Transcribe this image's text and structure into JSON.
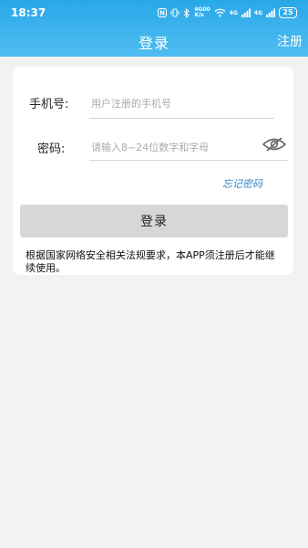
{
  "status": {
    "time": "18:37",
    "speed": "4G00\nK/s",
    "signal1": "4G",
    "signal2": "4G",
    "battery": "25"
  },
  "nav": {
    "title": "登录",
    "register_label": "注册"
  },
  "form": {
    "phone_label": "手机号:",
    "phone_placeholder": "用户注册的手机号",
    "password_label": "密码:",
    "password_placeholder": "请输入8~24位数字和字母",
    "forgot_label": "忘记密码",
    "login_label": "登录"
  },
  "notice": "根据国家网络安全相关法规要求，本APP须注册后才能继续使用。",
  "icons": {
    "eye": "eye-off-icon"
  },
  "colors": {
    "header_top": "#29a8e8",
    "header_bottom": "#4fbdf0",
    "button_bg": "#d7d7d7",
    "link": "#3a84c7"
  }
}
